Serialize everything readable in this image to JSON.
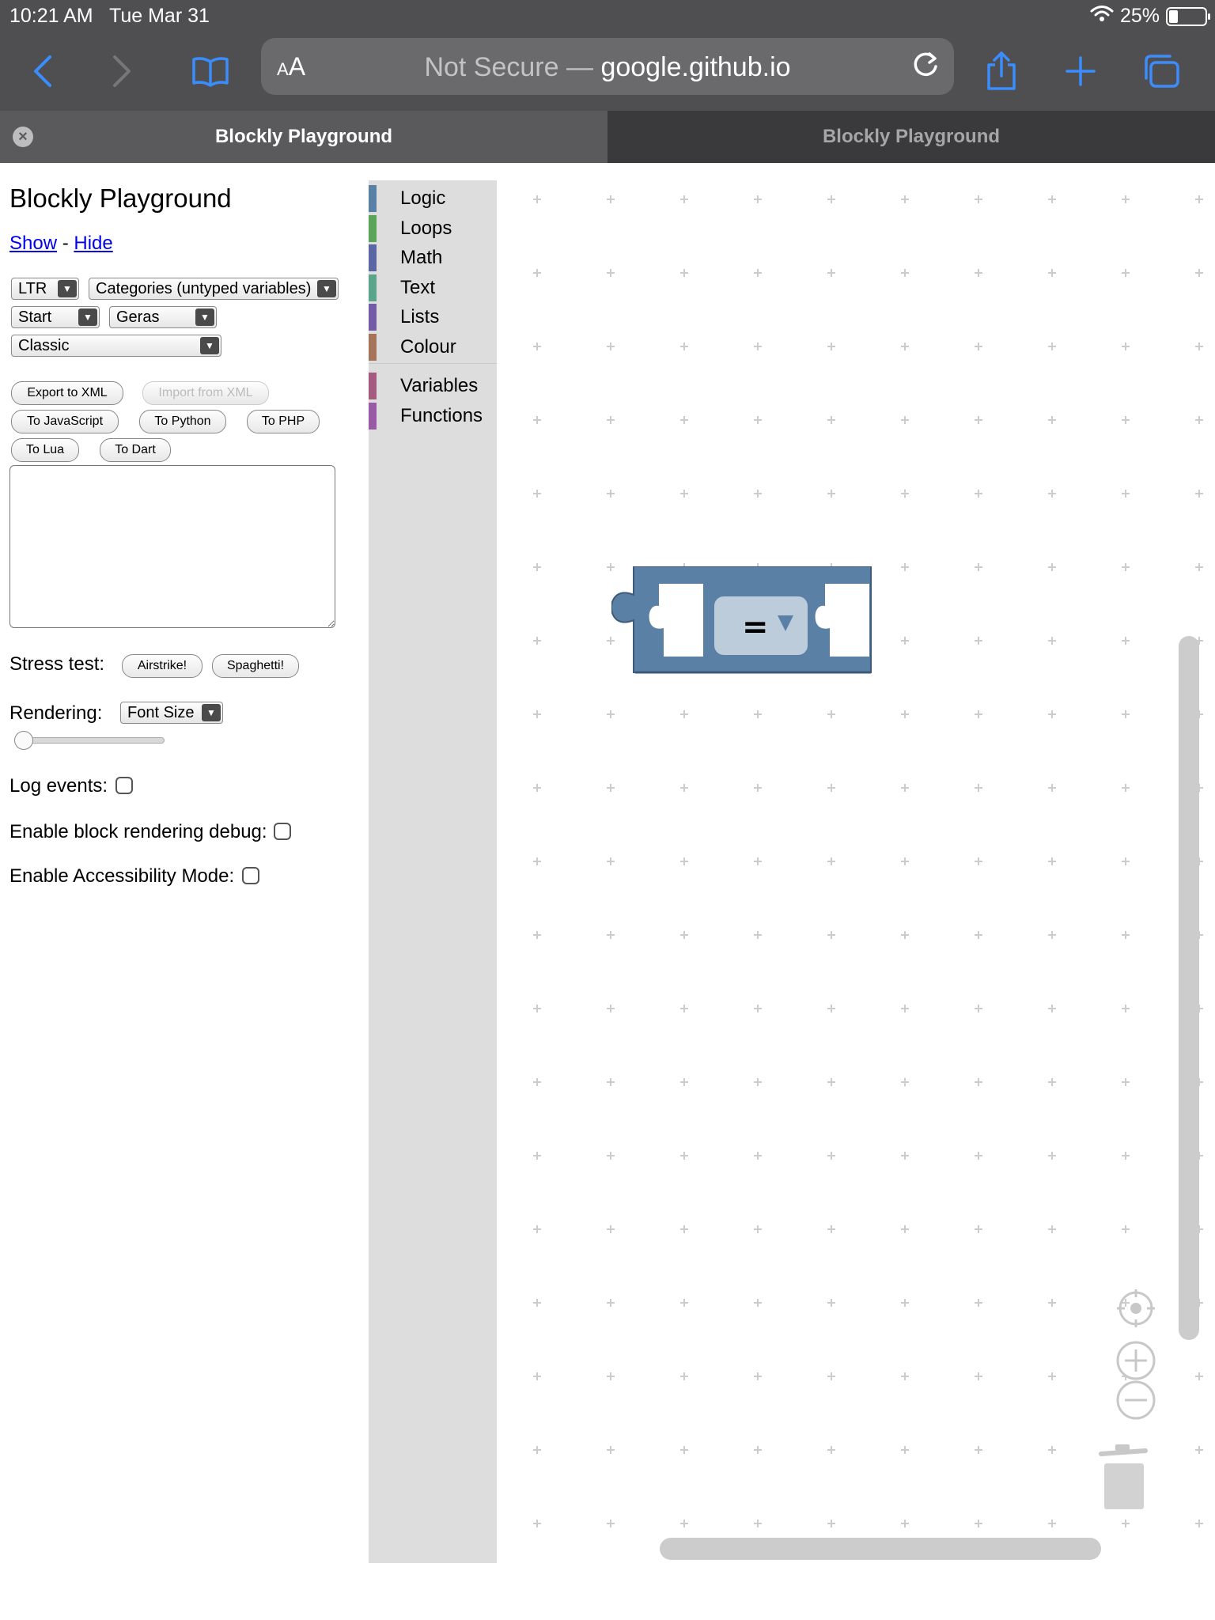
{
  "status_bar": {
    "time": "10:21 AM",
    "date": "Tue Mar 31",
    "battery_text": "25%",
    "battery_level": 0.25
  },
  "browser": {
    "aa_small": "A",
    "aa_large": "A",
    "url_prefix": "Not Secure — ",
    "url_domain": "google.github.io",
    "tabs": [
      {
        "title": "Blockly Playground",
        "active": true
      },
      {
        "title": "Blockly Playground",
        "active": false
      }
    ],
    "icons": [
      "back-icon",
      "forward-icon",
      "bookmarks-icon",
      "reload-icon",
      "share-icon",
      "new-tab-icon",
      "tabs-icon"
    ]
  },
  "left_panel": {
    "title": "Blockly Playground",
    "show_link": "Show",
    "separator": " - ",
    "hide_link": "Hide",
    "selects": {
      "direction": "LTR",
      "toolbox": "Categories (untyped variables)",
      "start": "Start",
      "renderer": "Geras",
      "theme": "Classic"
    },
    "buttons": {
      "export_xml": "Export to XML",
      "import_xml": "Import from XML",
      "to_javascript": "To JavaScript",
      "to_python": "To Python",
      "to_php": "To PHP",
      "to_lua": "To Lua",
      "to_dart": "To Dart"
    },
    "xml_textarea": "",
    "stress_test": {
      "label": "Stress test:",
      "airstrike": "Airstrike!",
      "spaghetti": "Spaghetti!"
    },
    "rendering": {
      "label": "Rendering:",
      "select": "Font Size",
      "slider_value": 0
    },
    "log_events": {
      "label": "Log events:",
      "checked": false
    },
    "render_debug": {
      "label": "Enable block rendering debug:",
      "checked": false
    },
    "accessibility": {
      "label": "Enable Accessibility Mode:",
      "checked": false
    }
  },
  "toolbox": {
    "categories": [
      {
        "label": "Logic",
        "color": "#5b80a5"
      },
      {
        "label": "Loops",
        "color": "#5ba55b"
      },
      {
        "label": "Math",
        "color": "#5b67a5"
      },
      {
        "label": "Text",
        "color": "#5ba58c"
      },
      {
        "label": "Lists",
        "color": "#745ba5"
      },
      {
        "label": "Colour",
        "color": "#a5745b"
      },
      {
        "label": "Variables",
        "color": "#a55b80"
      },
      {
        "label": "Functions",
        "color": "#995ba5"
      }
    ]
  },
  "workspace": {
    "block": {
      "type": "logic_compare",
      "operator": "=",
      "color": "#5b80a5"
    },
    "controls": [
      "recenter-icon",
      "zoom-in-icon",
      "zoom-out-icon",
      "trash-icon"
    ]
  }
}
